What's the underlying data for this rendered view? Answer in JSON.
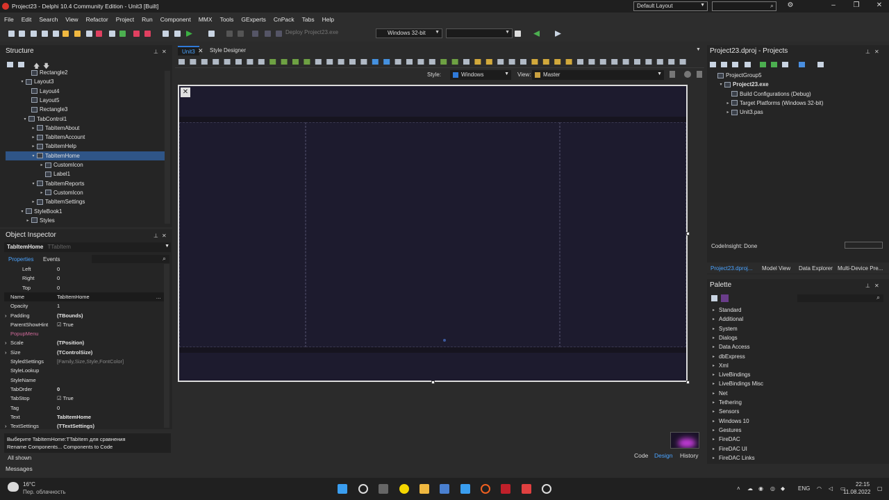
{
  "window": {
    "title": "Project23 - Delphi 10.4 Community Edition - Unit3 [Built]",
    "layout_value": "Default Layout"
  },
  "menu": [
    "File",
    "Edit",
    "Search",
    "View",
    "Refactor",
    "Project",
    "Run",
    "Component",
    "MMX",
    "Tools",
    "GExperts",
    "CnPack",
    "Tabs",
    "Help"
  ],
  "toolbar": {
    "deploy_label": "Deploy Project23.exe",
    "platform": "Windows 32-bit"
  },
  "structure": {
    "title": "Structure",
    "items": [
      {
        "label": "Rectangle2"
      },
      {
        "label": "Layout3"
      },
      {
        "label": "Layout4"
      },
      {
        "label": "Layout5"
      },
      {
        "label": "Rectangle3"
      },
      {
        "label": "TabControl1"
      },
      {
        "label": "TabItemAbout"
      },
      {
        "label": "TabItemAccount"
      },
      {
        "label": "TabItemHelp"
      },
      {
        "label": "TabItemHome"
      },
      {
        "label": "CustomIcon"
      },
      {
        "label": "Label1"
      },
      {
        "label": "TabItemReports"
      },
      {
        "label": "CustomIcon"
      },
      {
        "label": "TabItemSettings"
      },
      {
        "label": "StyleBook1"
      },
      {
        "label": "Styles"
      }
    ]
  },
  "inspector": {
    "title": "Object Inspector",
    "selected_name": "TabItemHome",
    "selected_type": "TTabItem",
    "tabs": [
      "Properties",
      "Events"
    ],
    "rows": [
      {
        "k": "Left",
        "v": "0"
      },
      {
        "k": "Right",
        "v": "0"
      },
      {
        "k": "Top",
        "v": "0"
      },
      {
        "k": "Name",
        "v": "TabItemHome"
      },
      {
        "k": "Opacity",
        "v": "1"
      },
      {
        "k": "Padding",
        "v": "(TBounds)"
      },
      {
        "k": "ParentShowHint",
        "v": "True"
      },
      {
        "k": "PopupMenu",
        "v": ""
      },
      {
        "k": "Scale",
        "v": "(TPosition)"
      },
      {
        "k": "Size",
        "v": "(TControlSize)"
      },
      {
        "k": "StyledSettings",
        "v": "[Family,Size,Style,FontColor]"
      },
      {
        "k": "StyleLookup",
        "v": ""
      },
      {
        "k": "StyleName",
        "v": ""
      },
      {
        "k": "TabOrder",
        "v": "0"
      },
      {
        "k": "TabStop",
        "v": "True"
      },
      {
        "k": "Tag",
        "v": "0"
      },
      {
        "k": "Text",
        "v": "TabItemHome"
      },
      {
        "k": "TextSettings",
        "v": "(TTextSettings)"
      }
    ],
    "hint_line1": "Выберите TabItemHome:TTabItem для сравнения",
    "hint_line2": "Rename Components... Components to Code",
    "status": "All shown"
  },
  "designer": {
    "tabs": [
      "Unit3",
      "Style Designer"
    ],
    "style_label": "Style:",
    "style_value": "Windows",
    "view_label": "View:",
    "view_value": "Master",
    "bottom_tabs": [
      "Code",
      "Design",
      "History"
    ]
  },
  "projects": {
    "title": "Project23.dproj - Projects",
    "items": [
      {
        "label": "ProjectGroup5"
      },
      {
        "label": "Project23.exe"
      },
      {
        "label": "Build Configurations (Debug)"
      },
      {
        "label": "Target Platforms (Windows 32-bit)"
      },
      {
        "label": "Unit3.pas"
      }
    ],
    "codeinsight": "CodeInsight: Done",
    "tabs": [
      "Project23.dproj...",
      "Model View",
      "Data Explorer",
      "Multi-Device Pre..."
    ]
  },
  "palette": {
    "title": "Palette",
    "items": [
      "Standard",
      "Additional",
      "System",
      "Dialogs",
      "Data Access",
      "dbExpress",
      "Xml",
      "LiveBindings",
      "LiveBindings Misc",
      "Net",
      "Tethering",
      "Sensors",
      "Windows 10",
      "Gestures",
      "FireDAC",
      "FireDAC UI",
      "FireDAC Links"
    ]
  },
  "messages": {
    "label": "Messages"
  },
  "taskbar": {
    "weather_temp": "16°C",
    "weather_desc": "Пер. облачность",
    "lang": "ENG",
    "time": "22:15",
    "date": "11.08.2022"
  }
}
